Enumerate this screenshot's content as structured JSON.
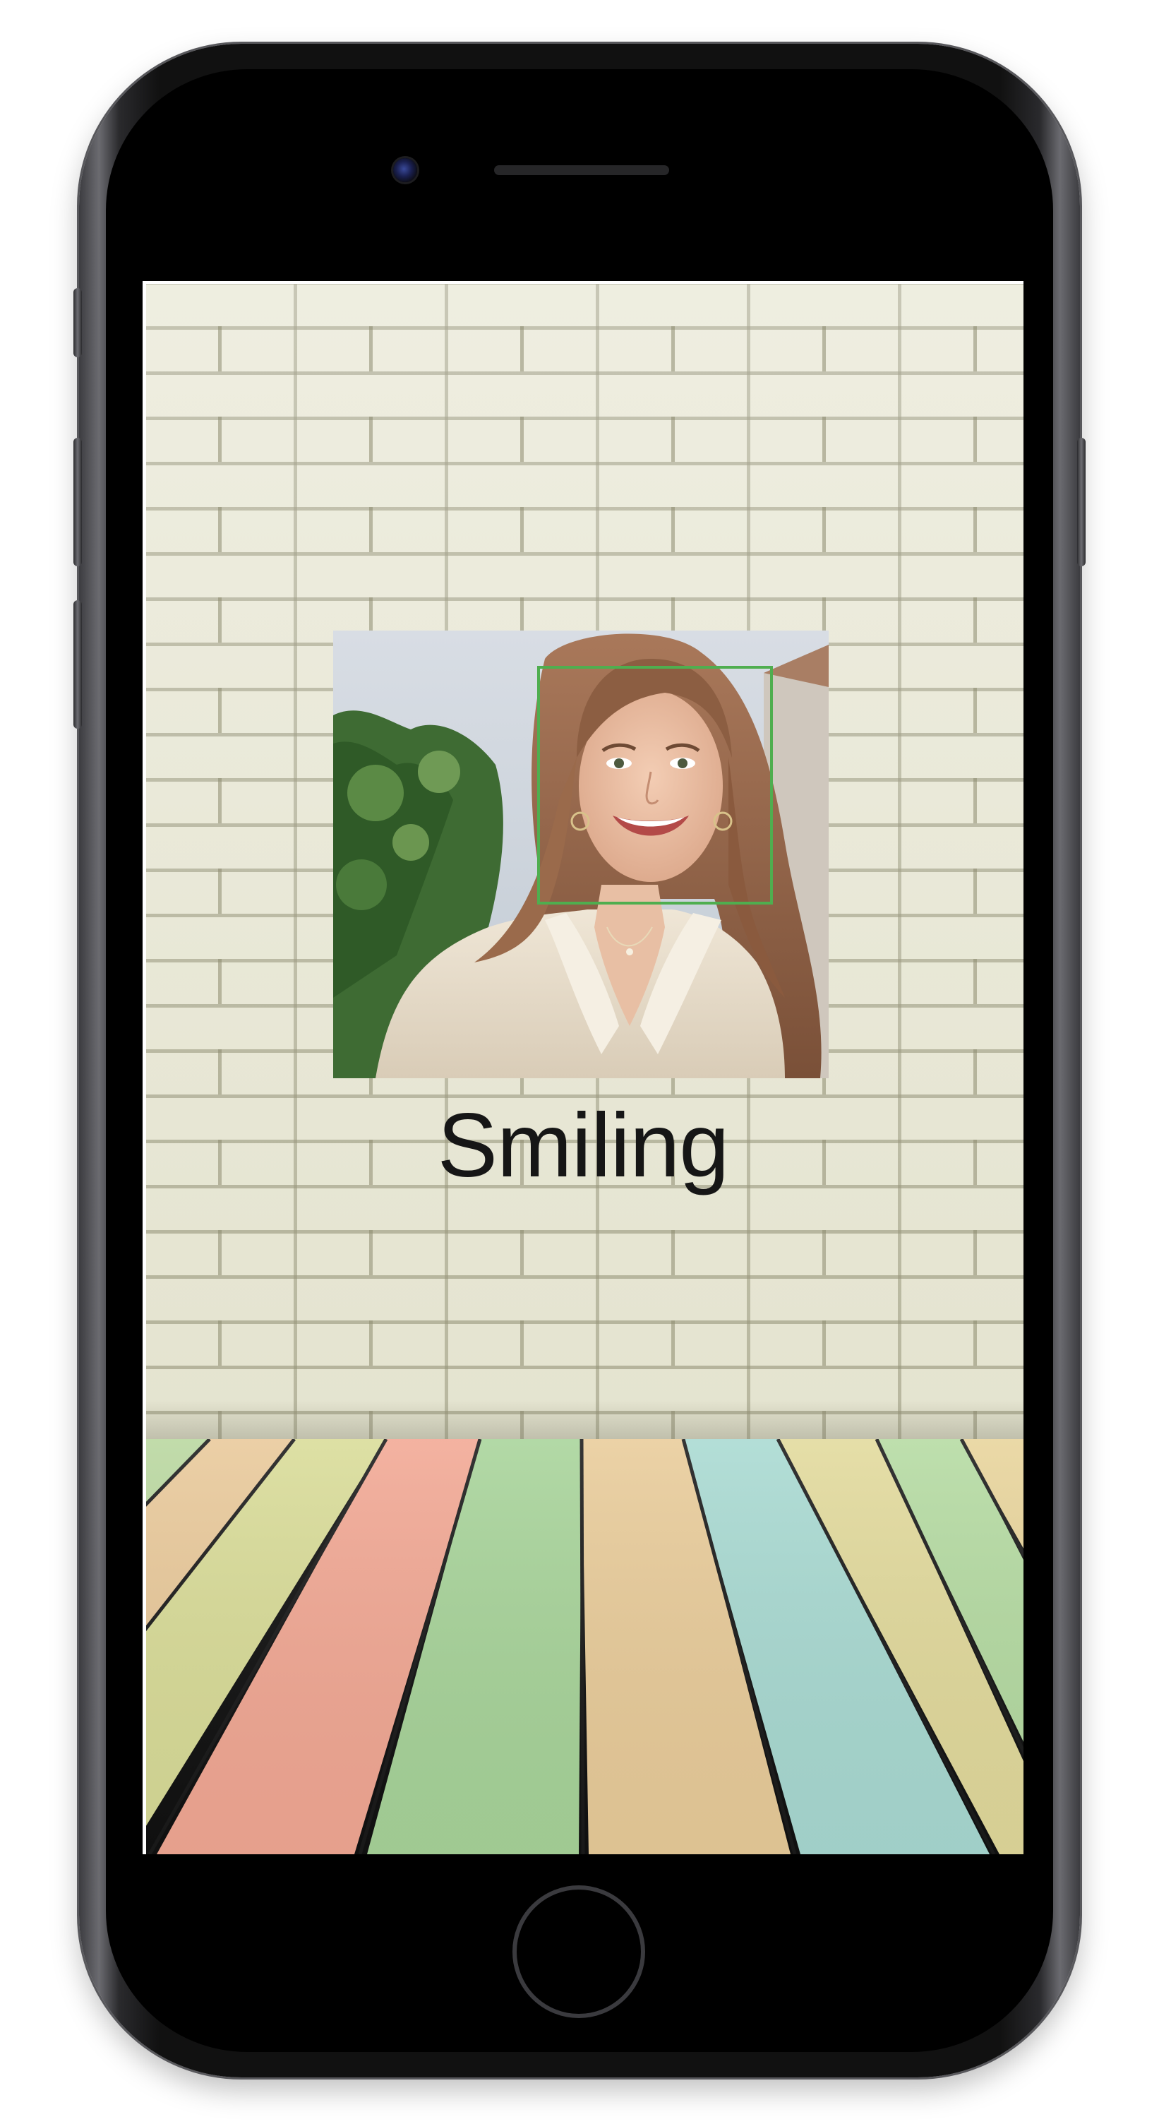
{
  "screen": {
    "result_label": "Smiling"
  },
  "face_detection": {
    "box_color": "#4fae4f"
  },
  "icons": {
    "front_camera": "camera-icon",
    "home_button": "home-button"
  }
}
